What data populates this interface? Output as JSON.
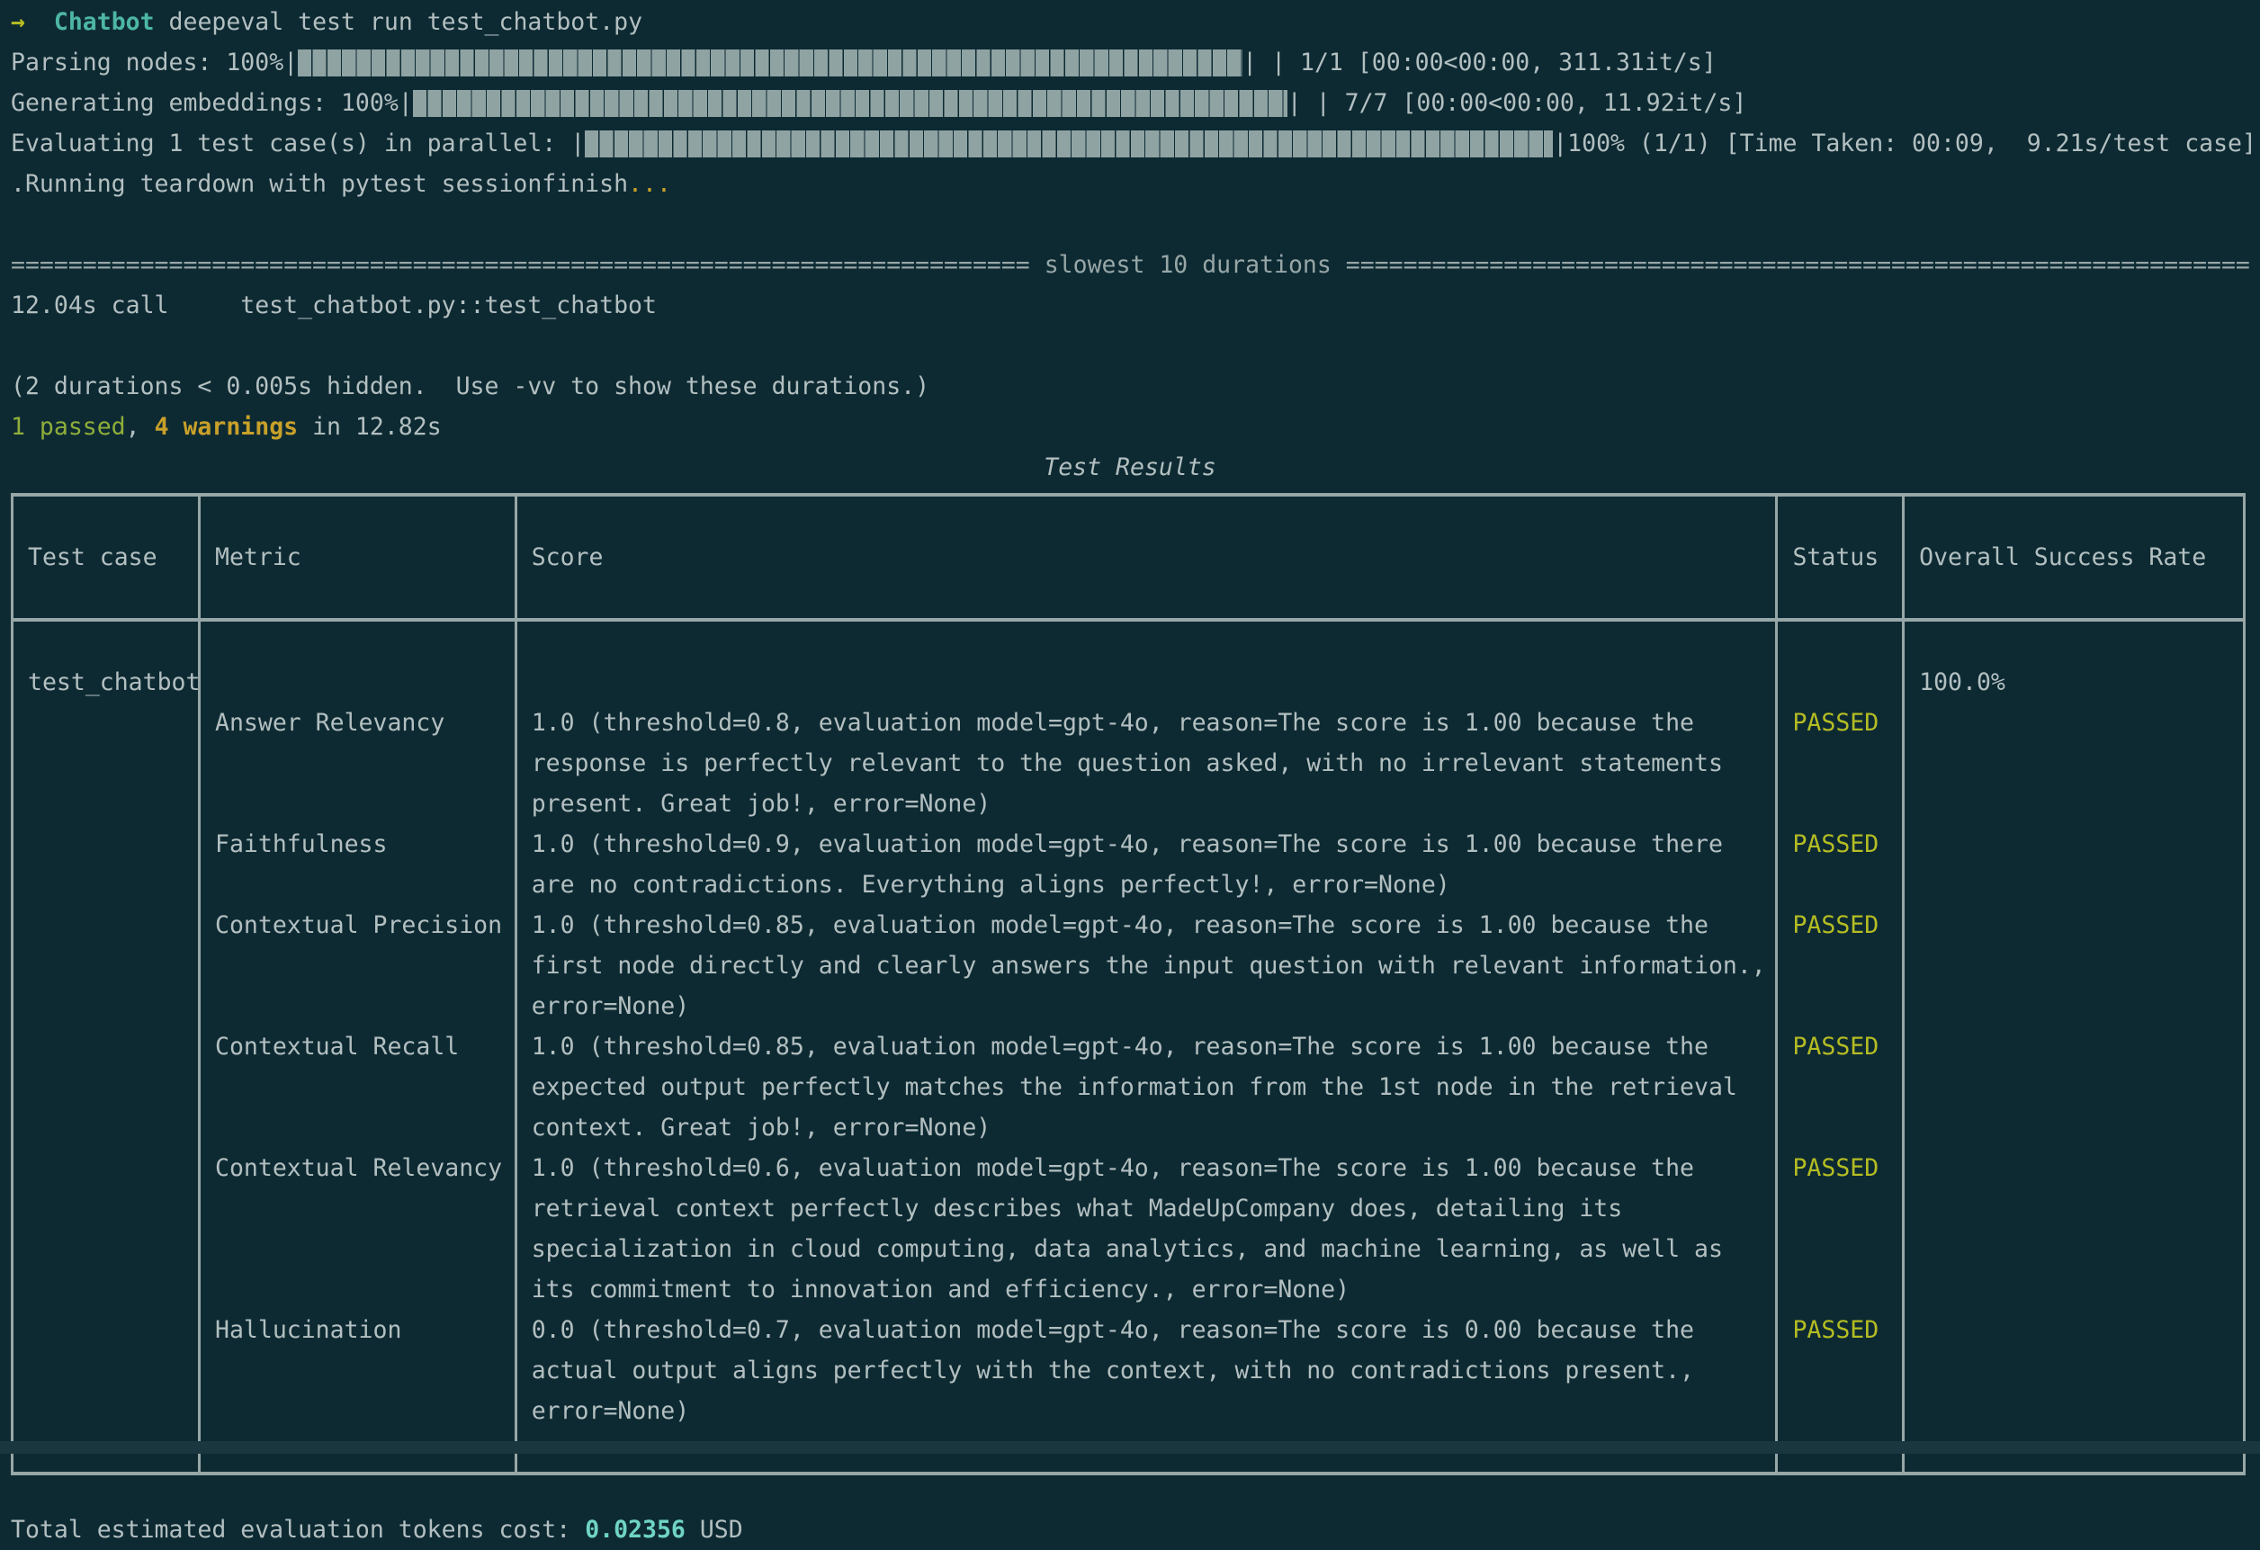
{
  "terminal": {
    "prompt": {
      "arrow": "→",
      "cwd": "Chatbot",
      "command": "deepeval test run test_chatbot.py"
    },
    "progress": [
      {
        "label": "Parsing nodes:",
        "percent": "100%",
        "bar_fill": 1.0,
        "stats": "| 1/1 [00:00<00:00, 311.31it/s]"
      },
      {
        "label": "Generating embeddings:",
        "percent": "100%",
        "bar_fill": 1.0,
        "stats": "| 7/7 [00:00<00:00, 11.92it/s]"
      },
      {
        "label": "Evaluating 1 test case(s) in parallel:",
        "percent": "",
        "bar_fill": 1.0,
        "stats": "|100% (1/1) [Time Taken: 00:09,  9.21s/test case]"
      }
    ],
    "teardown_line": ".Running teardown with pytest sessionfinish",
    "teardown_ellipsis": "...",
    "durations_header": "slowest 10 durations",
    "duration_rows": [
      "12.04s call     test_chatbot.py::test_chatbot"
    ],
    "hidden_durations_note": "(2 durations < 0.005s hidden.  Use -vv to show these durations.)",
    "summary": {
      "passed": "1 passed",
      "comma": ", ",
      "warnings": "4 warnings",
      "in_time": " in 12.82s"
    },
    "cost": {
      "label": "Total estimated evaluation tokens cost: ",
      "value": "0.02356",
      "currency": " USD"
    }
  },
  "table": {
    "title": "Test Results",
    "columns": [
      "Test case",
      "Metric",
      "Score",
      "Status",
      "Overall Success Rate"
    ],
    "test_case": "test_chatbot",
    "overall_success_rate": "100.0%",
    "rows": [
      {
        "metric": "Answer Relevancy",
        "score": "1.0 (threshold=0.8, evaluation model=gpt-4o, reason=The score is 1.00 because the response is perfectly relevant to the question asked, with no irrelevant statements present. Great job!, error=None)",
        "status": "PASSED"
      },
      {
        "metric": "Faithfulness",
        "score": "1.0 (threshold=0.9, evaluation model=gpt-4o, reason=The score is 1.00 because there are no contradictions. Everything aligns perfectly!, error=None)",
        "status": "PASSED"
      },
      {
        "metric": "Contextual Precision",
        "score": "1.0 (threshold=0.85, evaluation model=gpt-4o, reason=The score is 1.00 because the first node directly and clearly answers the input question with relevant information., error=None)",
        "status": "PASSED"
      },
      {
        "metric": "Contextual Recall",
        "score": "1.0 (threshold=0.85, evaluation model=gpt-4o, reason=The score is 1.00 because the expected output perfectly matches the information from the 1st node in the retrieval context. Great job!, error=None)",
        "status": "PASSED"
      },
      {
        "metric": "Contextual Relevancy",
        "score": "1.0 (threshold=0.6, evaluation model=gpt-4o, reason=The score is 1.00 because the retrieval context perfectly describes what MadeUpCompany does, detailing its specialization in cloud computing, data analytics, and machine learning, as well as its commitment to innovation and efficiency., error=None)",
        "status": "PASSED"
      },
      {
        "metric": "Hallucination",
        "score": "0.0 (threshold=0.7, evaluation model=gpt-4o, reason=The score is 0.00 because the actual output aligns perfectly with the context, with no contradictions present., error=None)",
        "status": "PASSED"
      }
    ]
  },
  "colors": {
    "background": "#0d2a33",
    "foreground": "#b3bfc0",
    "accent_cyan": "#6fd4c4",
    "accent_green": "#8fae3a",
    "accent_yellow": "#c8a02a",
    "status_passed": "#b5bd22",
    "rule": "#97a6a6"
  }
}
